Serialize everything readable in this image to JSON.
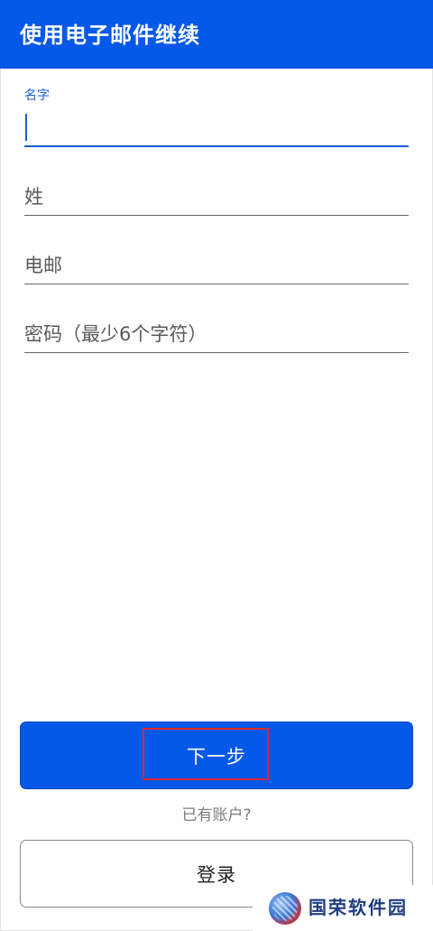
{
  "header": {
    "title": "使用电子邮件继续"
  },
  "form": {
    "first_name": {
      "label": "名字",
      "value": ""
    },
    "last_name": {
      "placeholder": "姓"
    },
    "email": {
      "placeholder": "电邮"
    },
    "password": {
      "placeholder": "密码（最少6个字符）"
    }
  },
  "actions": {
    "next_label": "下一步",
    "have_account_text": "已有账户?",
    "login_label": "登录"
  },
  "watermark": {
    "text": "国荣软件园"
  },
  "colors": {
    "primary": "#0558e8",
    "focus": "#1560d8",
    "highlight_box": "#e0262e"
  }
}
